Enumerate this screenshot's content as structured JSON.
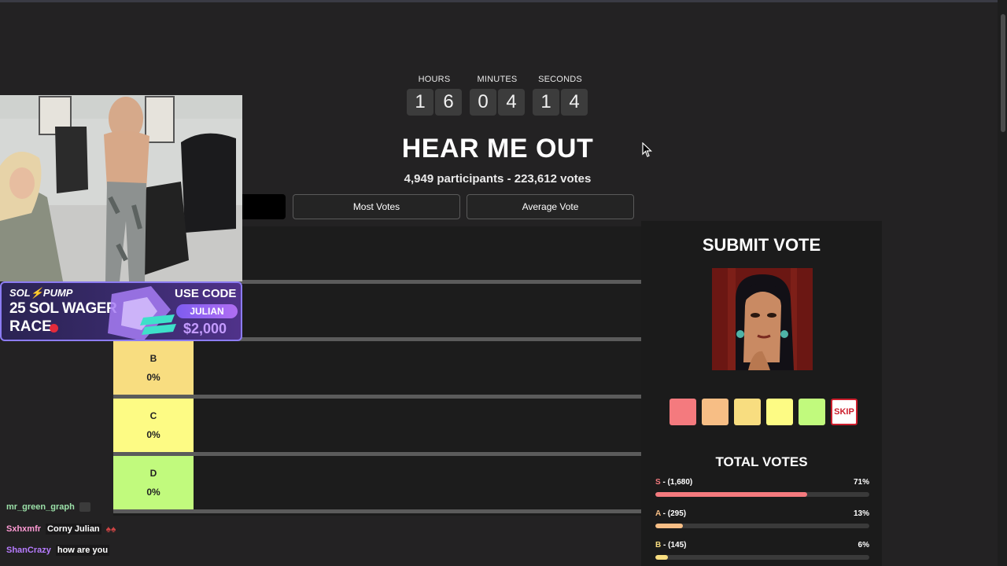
{
  "countdown": {
    "hours_label": "HOURS",
    "minutes_label": "MINUTES",
    "seconds_label": "SECONDS",
    "h1": "1",
    "h2": "6",
    "m1": "0",
    "m2": "4",
    "s1": "1",
    "s2": "4"
  },
  "title": "HEAR ME OUT",
  "stats": "4,949 participants - 223,612 votes",
  "sort": {
    "most_votes": "Most Votes",
    "average_vote": "Average Vote"
  },
  "tiers": [
    {
      "letter": "B",
      "pct": "0%",
      "color": "#f8dd80"
    },
    {
      "letter": "C",
      "pct": "0%",
      "color": "#fdfb84"
    },
    {
      "letter": "D",
      "pct": "0%",
      "color": "#c1fa7d"
    }
  ],
  "submit": {
    "title": "SUBMIT VOTE",
    "vote_colors": [
      "#f47a7e",
      "#f7be85",
      "#f8dd80",
      "#fdfb84",
      "#c1fa7d"
    ],
    "skip": "SKIP"
  },
  "total": {
    "title": "TOTAL VOTES",
    "rows": [
      {
        "tier": "S",
        "count": " - (1,680)",
        "pct": "71%",
        "fraction": 0.71,
        "color": "#f47a7e"
      },
      {
        "tier": "A",
        "count": " - (295)",
        "pct": "13%",
        "fraction": 0.13,
        "color": "#f7be85"
      },
      {
        "tier": "B",
        "count": " - (145)",
        "pct": "6%",
        "fraction": 0.06,
        "color": "#f8dd80"
      }
    ]
  },
  "ad": {
    "brand": "SOL⚡PUMP",
    "line1": "25 SOL WAGER",
    "line2": "RACE",
    "use_code": "USE CODE",
    "code": "JULIAN",
    "amount": "$2,000"
  },
  "chat": [
    {
      "user": "mr_green_graph",
      "msg": "",
      "color": "#9be0a8"
    },
    {
      "user": "Sxhxmfr",
      "msg": "Corny Julian",
      "color": "#ff9bd5"
    },
    {
      "user": "ShanCrazy",
      "msg": "how are you",
      "color": "#b77cff"
    }
  ]
}
